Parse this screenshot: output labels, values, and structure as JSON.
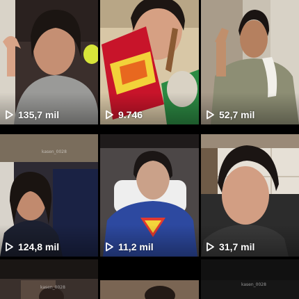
{
  "videos": [
    {
      "views": "135,7 mil",
      "colors": {
        "bg": "#3b2f2c",
        "shirt": "#9a9a98"
      }
    },
    {
      "views": "9.746",
      "colors": {
        "bg": "#d8c7a6",
        "shirt": "#c8142a"
      }
    },
    {
      "views": "52,7 mil",
      "colors": {
        "bg": "#c9c1b3",
        "shirt": "#8d8e74"
      }
    },
    {
      "views": "124,8 mil",
      "colors": {
        "bg": "#2d2a33",
        "shirt": "#1c2030"
      }
    },
    {
      "views": "11,2 mil",
      "colors": {
        "bg": "#4c4747",
        "shirt": "#2d49a0"
      }
    },
    {
      "views": "31,7 mil",
      "colors": {
        "bg": "#9a8a78",
        "shirt": "#3a3a3a"
      }
    },
    {
      "views": "",
      "colors": {
        "bg": "#3a302c",
        "shirt": "#2a2a2a"
      }
    },
    {
      "views": "",
      "colors": {
        "bg": "#6b5a4a",
        "shirt": "#2a2a2a"
      }
    },
    {
      "views": "",
      "colors": {
        "bg": "#111111",
        "shirt": "#2a2a2a"
      }
    }
  ],
  "watermarks": [
    "kasen_0028",
    "kasen_0028",
    "kasen_0028"
  ],
  "icons": {
    "play": "play-outline-icon"
  },
  "theme": {
    "background": "#000000",
    "text": "#ffffff"
  }
}
